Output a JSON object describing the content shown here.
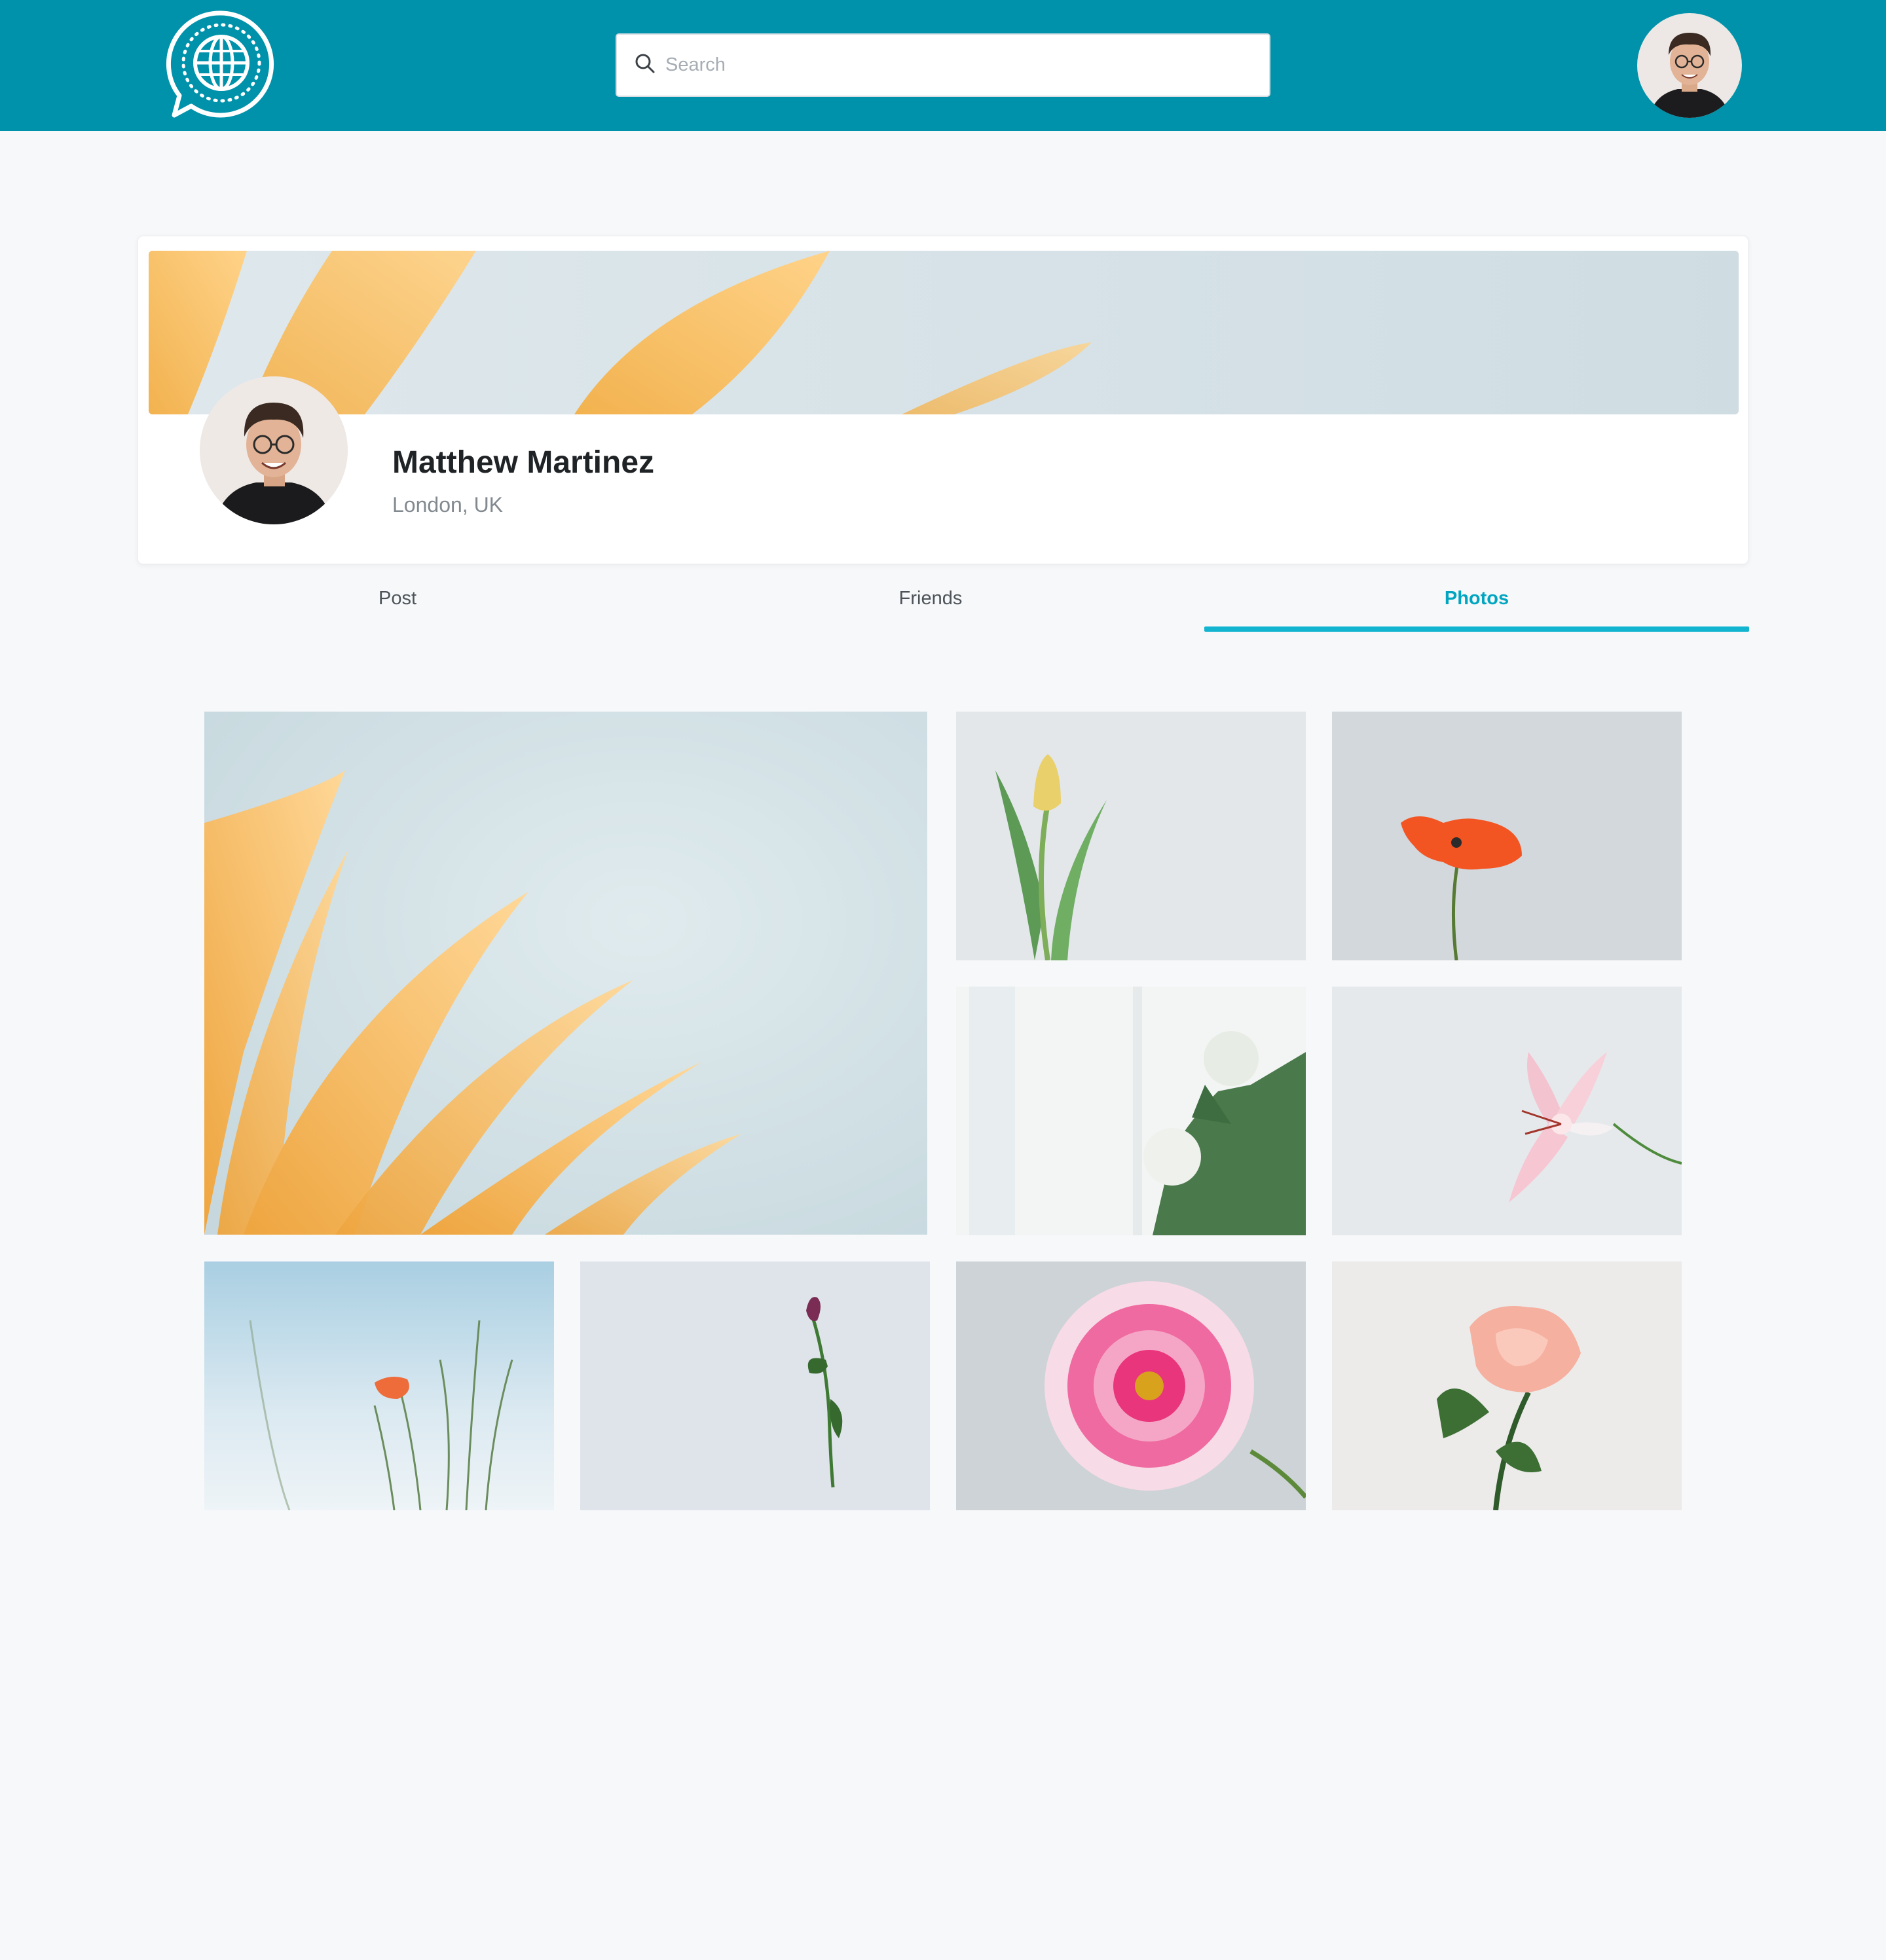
{
  "header": {
    "logo_icon": "globe-chat-icon",
    "search_placeholder": "Search",
    "search_icon": "search-icon",
    "user_avatar": "user-avatar"
  },
  "profile": {
    "name": "Matthew Martinez",
    "location": "London, UK",
    "cover": "yellow-petals-cover"
  },
  "tabs": [
    {
      "label": "Post",
      "active": false
    },
    {
      "label": "Friends",
      "active": false
    },
    {
      "label": "Photos",
      "active": true
    }
  ],
  "photos": [
    "yellow-petals-photo",
    "yellow-tulip-photo",
    "red-poppy-photo",
    "white-roses-photo",
    "pink-lily-photo",
    "orange-poppy-sky-photo",
    "purple-bud-photo",
    "pink-dahlia-photo",
    "peach-rose-photo"
  ],
  "colors": {
    "brand": "#0092aa",
    "accent": "#12b4cf",
    "background": "#f7f8fa"
  }
}
